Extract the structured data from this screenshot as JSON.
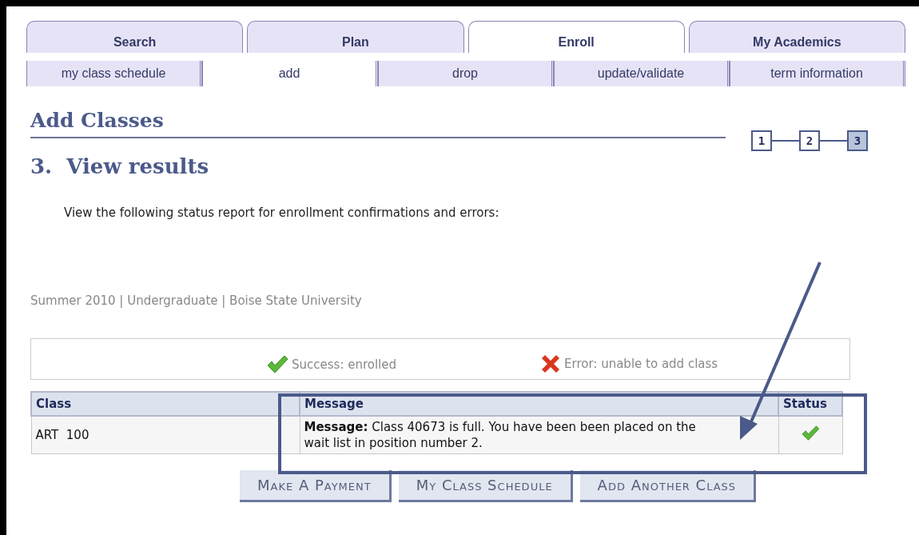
{
  "tabs": [
    {
      "label": "Search",
      "selected": false
    },
    {
      "label": "Plan",
      "selected": false
    },
    {
      "label": "Enroll",
      "selected": true
    },
    {
      "label": "My Academics",
      "selected": false
    }
  ],
  "subtabs": [
    {
      "label": "my class schedule",
      "selected": false
    },
    {
      "label": "add",
      "selected": true
    },
    {
      "label": "drop",
      "selected": false
    },
    {
      "label": "update/validate",
      "selected": false
    },
    {
      "label": "term information",
      "selected": false
    }
  ],
  "page_title": "Add Classes",
  "steps": [
    {
      "label": "1",
      "selected": false
    },
    {
      "label": "2",
      "selected": false
    },
    {
      "label": "3",
      "selected": true
    }
  ],
  "step_title": "3.  View results",
  "instructions": "View the following status report for enrollment confirmations and errors:",
  "term_info": "Summer 2010 | Undergraduate | Boise State University",
  "legend": [
    {
      "kind": "success",
      "label": "Success: enrolled"
    },
    {
      "kind": "error",
      "label": "Error: unable to add class"
    }
  ],
  "table": {
    "columns": [
      "Class",
      "Message",
      "Status"
    ],
    "rows": [
      {
        "class": "ART  100",
        "message": "**Message:** Class 40673 is full. You have been been placed on the wait list in position number 2.",
        "kind": "success"
      }
    ]
  },
  "buttons": [
    "Make A Payment",
    "My Class Schedule",
    "Add Another Class"
  ]
}
